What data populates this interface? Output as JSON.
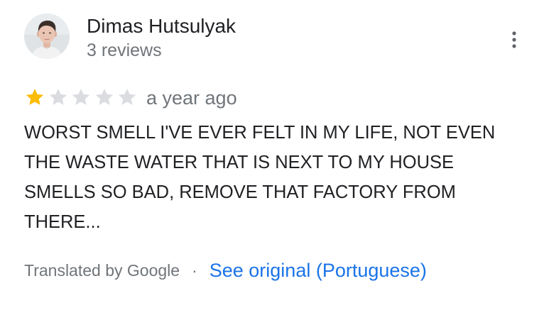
{
  "reviewer": {
    "name": "Dimas Hutsulyak",
    "reviews_count": "3 reviews",
    "avatar_icon": "profile-photo"
  },
  "menu": {
    "icon": "more-vert-icon"
  },
  "rating": {
    "stars_filled": 1,
    "stars_total": 5,
    "filled_color": "#fbbc04",
    "empty_color": "#dadce0"
  },
  "review": {
    "time_ago": "a year ago",
    "text": "WORST SMELL I'VE EVER FELT IN MY LIFE, NOT EVEN\nTHE WASTE WATER THAT IS NEXT TO MY HOUSE\nSMELLS SO BAD, REMOVE THAT FACTORY FROM\nTHERE..."
  },
  "translation": {
    "translated_by": "Translated by Google",
    "separator": "·",
    "see_original": "See original (Portuguese)",
    "link_color": "#1a73e8"
  }
}
